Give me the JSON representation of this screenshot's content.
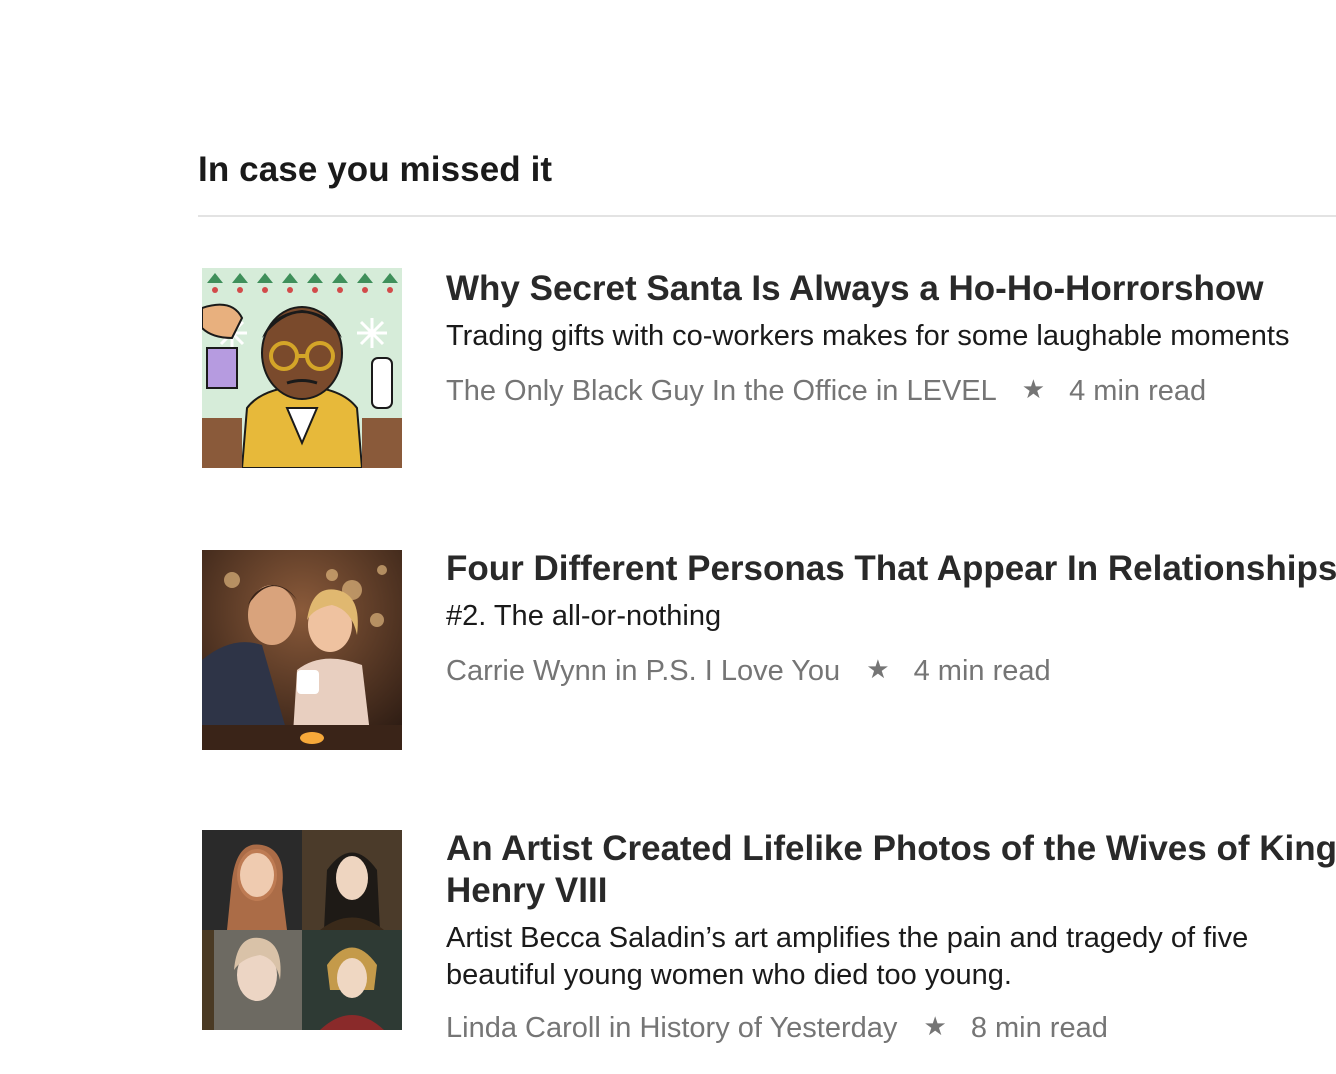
{
  "section": {
    "title": "In case you missed it"
  },
  "articles": [
    {
      "title": "Why Secret Santa Is Always a Ho-Ho-Horrorshow",
      "subtitle": "Trading gifts with co-workers makes for some laughable moments",
      "author": "The Only Black Guy In the Office",
      "in_word": "in",
      "publication": "LEVEL",
      "read_time": "4 min read"
    },
    {
      "title": "Four Different Personas That Appear In Relationships",
      "subtitle": "#2. The all-or-nothing",
      "author": "Carrie Wynn",
      "in_word": "in",
      "publication": "P.S. I Love You",
      "read_time": "4 min read"
    },
    {
      "title": "An Artist Created Lifelike Photos of the Wives of King Henry VIII",
      "subtitle": "Artist Becca Saladin’s art amplifies the pain and tragedy of five beautiful young women who died too young.",
      "author": "Linda Caroll",
      "in_word": "in",
      "publication": "History of Yesterday",
      "read_time": "8 min read"
    }
  ],
  "icons": {
    "separator": "star-icon"
  },
  "colors": {
    "meta_text": "#757575",
    "headline": "#292929",
    "divider": "#e3e3e3"
  }
}
